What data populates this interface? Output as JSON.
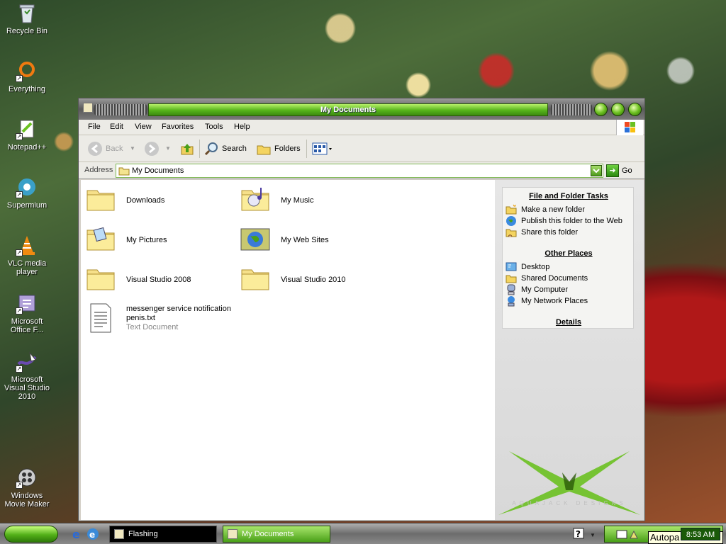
{
  "desktop": {
    "icons": [
      {
        "label": "Recycle Bin",
        "icon": "recycle-bin-icon"
      },
      {
        "label": "Everything",
        "icon": "everything-search-icon"
      },
      {
        "label": "Notepad++",
        "icon": "notepad-plus-icon"
      },
      {
        "label": "Supermium",
        "icon": "browser-icon"
      },
      {
        "label": "VLC media player",
        "icon": "vlc-cone-icon"
      },
      {
        "label": "Microsoft Office F...",
        "icon": "office-icon"
      },
      {
        "label": "Microsoft Visual Studio 2010",
        "icon": "visual-studio-icon"
      },
      {
        "label": "Windows Movie Maker",
        "icon": "movie-maker-icon"
      }
    ]
  },
  "window": {
    "title": "My Documents",
    "menu": [
      "File",
      "Edit",
      "View",
      "Favorites",
      "Tools",
      "Help"
    ],
    "toolbar": {
      "back": "Back",
      "search": "Search",
      "folders": "Folders"
    },
    "address": {
      "label": "Address",
      "value": "My Documents",
      "go": "Go"
    },
    "files": [
      {
        "name": "Downloads",
        "type": "folder"
      },
      {
        "name": "My Music",
        "type": "music-folder"
      },
      {
        "name": "My Pictures",
        "type": "pictures-folder"
      },
      {
        "name": "My Web Sites",
        "type": "web-folder"
      },
      {
        "name": "Visual Studio 2008",
        "type": "folder"
      },
      {
        "name": "Visual Studio 2010",
        "type": "folder"
      },
      {
        "name": "messenger service notification penis.txt",
        "sub": "Text Document",
        "type": "text"
      }
    ],
    "taskpane": {
      "file_tasks_title": "File and Folder Tasks",
      "file_tasks": [
        "Make a new folder",
        "Publish this folder to the Web",
        "Share this folder"
      ],
      "other_places_title": "Other Places",
      "other_places": [
        "Desktop",
        "Shared Documents",
        "My Computer",
        "My Network Places"
      ],
      "details_title": "Details",
      "brand_text": "AQUAJACK DESIGNS"
    }
  },
  "taskbar": {
    "tasks": [
      "Flashing",
      "My Documents"
    ],
    "clock": "8:53 AM",
    "tooltip": "Autopa"
  },
  "colors": {
    "accent": "#56b41a",
    "window_bg": "#d4d0c8"
  }
}
